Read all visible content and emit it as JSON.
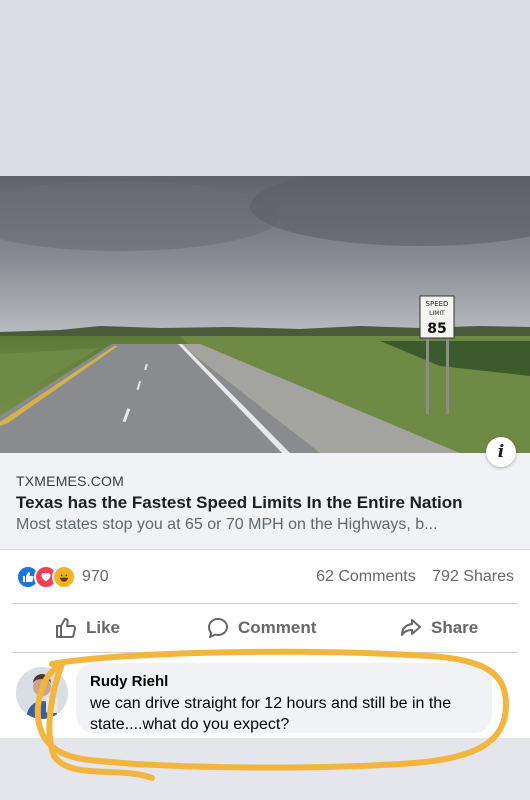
{
  "post": {
    "link_domain": "TXMEMES.COM",
    "link_title": "Texas has the Fastest Speed Limits In the Entire Nation",
    "link_description": "Most states stop you at 65 or 70 MPH on the Highways, b...",
    "sign": {
      "line1": "SPEED",
      "line2": "LIMIT",
      "value": "85"
    }
  },
  "stats": {
    "reactions": [
      "like-icon",
      "love-icon",
      "haha-icon"
    ],
    "reaction_count": "970",
    "comments": "62 Comments",
    "shares": "792 Shares"
  },
  "actions": {
    "like": "Like",
    "comment": "Comment",
    "share": "Share"
  },
  "comment": {
    "author": "Rudy Riehl",
    "text": "we can drive straight for 12 hours and still be in the state....what do you expect?"
  },
  "colors": {
    "accent": "#1b74e4",
    "love": "#f33e58",
    "haha": "#f7b125",
    "highlight": "#f2b63f"
  }
}
